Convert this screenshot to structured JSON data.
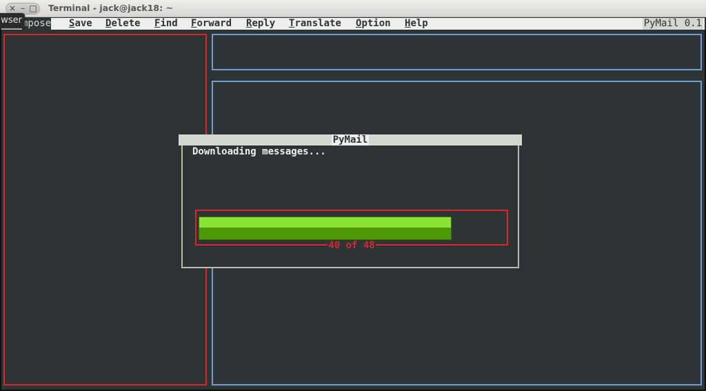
{
  "window": {
    "title": "Terminal - jack@jack18: ~",
    "controls": {
      "close": "×",
      "minimize": "–",
      "maximize": "□"
    }
  },
  "tooltip": {
    "text": "wser"
  },
  "menubar": {
    "items": [
      {
        "label_pre": "",
        "label_ul": "",
        "label_post": "mpose",
        "active": true
      },
      {
        "label_pre": "",
        "label_ul": "S",
        "label_post": "ave"
      },
      {
        "label_pre": "",
        "label_ul": "D",
        "label_post": "elete"
      },
      {
        "label_pre": "",
        "label_ul": "F",
        "label_post": "ind"
      },
      {
        "label_pre": "",
        "label_ul": "F",
        "label_post": "orward"
      },
      {
        "label_pre": "",
        "label_ul": "R",
        "label_post": "eply"
      },
      {
        "label_pre": "",
        "label_ul": "T",
        "label_post": "ranslate"
      },
      {
        "label_pre": "",
        "label_ul": "O",
        "label_post": "ption"
      },
      {
        "label_pre": "",
        "label_ul": "H",
        "label_post": "elp"
      }
    ],
    "app_version": "PyMail 0.1"
  },
  "dialog": {
    "title": "PyMail",
    "message": "Downloading messages...",
    "progress": {
      "current": 40,
      "total": 48,
      "label": "40 of 48",
      "fill_color_light": "#8ae234",
      "fill_color_dark": "#4e9a06"
    }
  },
  "colors": {
    "background": "#2e3436",
    "folder_panel_border": "#d9272e",
    "message_panel_border": "#729fcf",
    "dialog_border": "#babdb6"
  }
}
